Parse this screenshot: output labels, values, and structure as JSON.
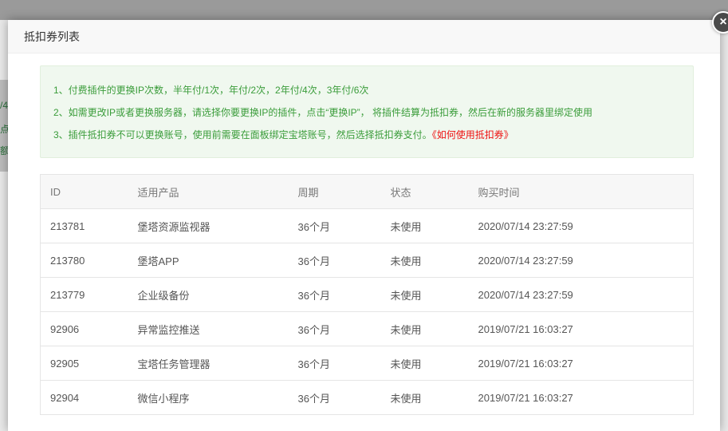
{
  "modal": {
    "title": "抵扣券列表",
    "close_icon_glyph": "×"
  },
  "background": {
    "fragments": [
      "/4",
      "点",
      "额"
    ]
  },
  "notice": {
    "line1": "1、付费插件的更换IP次数，半年付/1次，年付/2次，2年付/4次，3年付/6次",
    "line2": "2、如需更改IP或者更换服务器，请选择你要更换IP的插件，点击“更换IP”， 将插件结算为抵扣券，然后在新的服务器里绑定使用",
    "line3_text": "3、插件抵扣券不可以更换账号，使用前需要在面板绑定宝塔账号，然后选择抵扣券支付。",
    "line3_link": "《如何使用抵扣券》"
  },
  "table": {
    "headers": {
      "id": "ID",
      "product": "适用产品",
      "period": "周期",
      "status": "状态",
      "time": "购买时间"
    },
    "rows": [
      {
        "id": "213781",
        "product": "堡塔资源监视器",
        "period": "36个月",
        "status": "未使用",
        "time": "2020/07/14 23:27:59"
      },
      {
        "id": "213780",
        "product": "堡塔APP",
        "period": "36个月",
        "status": "未使用",
        "time": "2020/07/14 23:27:59"
      },
      {
        "id": "213779",
        "product": "企业级备份",
        "period": "36个月",
        "status": "未使用",
        "time": "2020/07/14 23:27:59"
      },
      {
        "id": "92906",
        "product": "异常监控推送",
        "period": "36个月",
        "status": "未使用",
        "time": "2019/07/21 16:03:27"
      },
      {
        "id": "92905",
        "product": "宝塔任务管理器",
        "period": "36个月",
        "status": "未使用",
        "time": "2019/07/21 16:03:27"
      },
      {
        "id": "92904",
        "product": "微信小程序",
        "period": "36个月",
        "status": "未使用",
        "time": "2019/07/21 16:03:27"
      }
    ]
  },
  "colors": {
    "notice_text": "#3a9c3a",
    "notice_link": "#ee1111",
    "status_unused": "#5ab25a"
  }
}
